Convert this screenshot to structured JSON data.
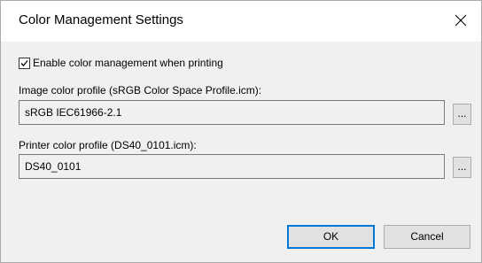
{
  "window": {
    "title": "Color Management Settings"
  },
  "enable_option": {
    "label": "Enable color management when printing",
    "checked": true
  },
  "image_profile": {
    "label": "Image color profile (sRGB Color Space Profile.icm):",
    "value": "sRGB IEC61966-2.1",
    "browse_label": "..."
  },
  "printer_profile": {
    "label": "Printer color profile (DS40_0101.icm):",
    "value": "DS40_0101",
    "browse_label": "..."
  },
  "buttons": {
    "ok_label": "OK",
    "cancel_label": "Cancel"
  },
  "colors": {
    "focus_border": "#0078d7",
    "dialog_background": "#f0f0f0"
  },
  "icons": {
    "close": "close-icon",
    "check": "checkmark-icon"
  }
}
